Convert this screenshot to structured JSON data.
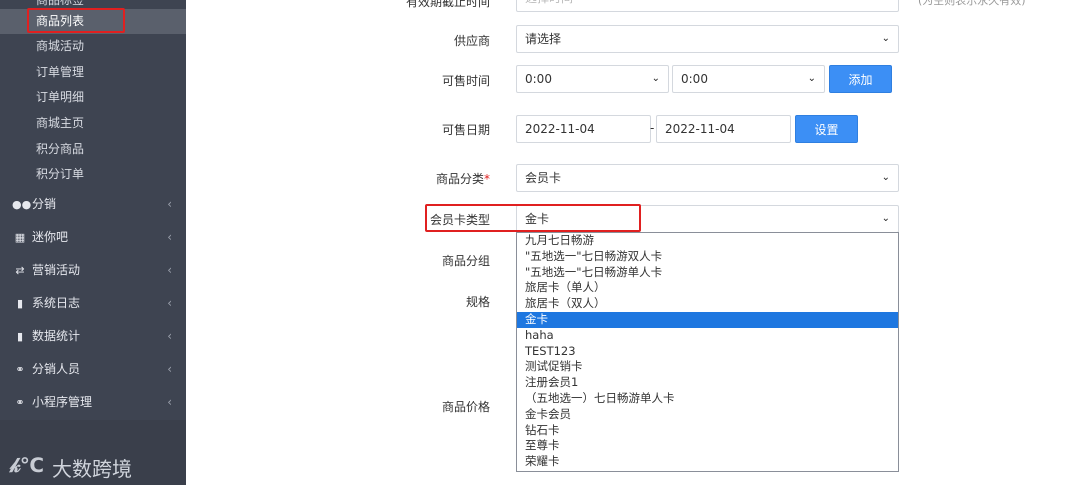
{
  "sidebar": {
    "cut_item": "商品标签",
    "sub_items": [
      {
        "label": "商品列表",
        "active": true
      },
      {
        "label": "商城活动"
      },
      {
        "label": "订单管理"
      },
      {
        "label": "订单明细"
      },
      {
        "label": "商城主页"
      },
      {
        "label": "积分商品"
      },
      {
        "label": "积分订单"
      }
    ],
    "menu_items": [
      {
        "label": "分销",
        "icon": "users-icon"
      },
      {
        "label": "迷你吧",
        "icon": "grid-icon"
      },
      {
        "label": "营销活动",
        "icon": "shuffle-icon"
      },
      {
        "label": "系统日志",
        "icon": "file-icon"
      },
      {
        "label": "数据统计",
        "icon": "file-icon"
      },
      {
        "label": "分销人员",
        "icon": "chat-icon"
      },
      {
        "label": "小程序管理",
        "icon": "chat-icon"
      }
    ],
    "chevron": "‹",
    "brand_logo": "𝓀℃",
    "brand_text": "大数跨境"
  },
  "form": {
    "top_label_partial": "有效期截止时间",
    "top_input_partial": "选择时间",
    "top_hint_partial": "(为空则表示永久有效)",
    "supplier": {
      "label": "供应商",
      "value": "请选择"
    },
    "sale_time": {
      "label": "可售时间",
      "start": "0:00",
      "end": "0:00",
      "button": "添加"
    },
    "sale_date": {
      "label": "可售日期",
      "start": "2022-11-04",
      "separator": "-",
      "end": "2022-11-04",
      "button": "设置"
    },
    "category": {
      "label": "商品分类",
      "required_mark": "*",
      "value": "会员卡"
    },
    "card_type": {
      "label": "会员卡类型",
      "value": "金卡"
    },
    "group": {
      "label": "商品分组"
    },
    "spec": {
      "label": "规格"
    },
    "price": {
      "label": "商品价格"
    }
  },
  "dropdown": {
    "options": [
      "九月七日畅游",
      "\"五地选一\"七日畅游双人卡",
      "\"五地选一\"七日畅游单人卡",
      "旅居卡（单人）",
      "旅居卡（双人）",
      "金卡",
      "haha",
      "TEST123",
      "测试促销卡",
      "注册会员1",
      "（五地选一）七日畅游单人卡",
      "金卡会员",
      "钻石卡",
      "至尊卡",
      "荣耀卡"
    ],
    "selected_index": 5
  },
  "colors": {
    "sidebar_bg": "#3e4451",
    "accent_blue": "#3c8ff5",
    "highlight_red": "#e02020",
    "selected_option": "#1e77e0"
  }
}
